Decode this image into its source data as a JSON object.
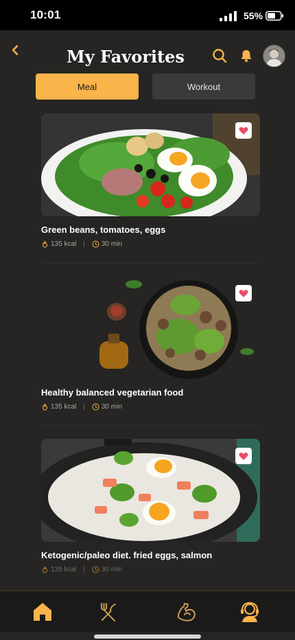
{
  "status_bar": {
    "time": "10:01",
    "battery": "55%"
  },
  "header": {
    "title": "My Favorites"
  },
  "tabs": [
    {
      "label": "Meal",
      "active": true
    },
    {
      "label": "Workout",
      "active": false
    }
  ],
  "meals": [
    {
      "name": "Green beans, tomatoes, eggs",
      "kcal": "135 kcal",
      "time": "30 min",
      "favorite": true
    },
    {
      "name": "Healthy balanced vegetarian food",
      "kcal": "135 kcal",
      "time": "30 min",
      "favorite": true
    },
    {
      "name": "Ketogenic/paleo diet. fried eggs, salmon",
      "kcal": "135 kcal",
      "time": "30 min",
      "favorite": true
    }
  ],
  "nav": [
    {
      "icon": "home-icon",
      "active": true
    },
    {
      "icon": "utensils-icon",
      "active": false
    },
    {
      "icon": "muscle-arm-icon",
      "active": false
    },
    {
      "icon": "support-agent-icon",
      "active": false
    }
  ],
  "colors": {
    "accent": "#f9b44a",
    "background": "#262523",
    "heart": "#e94e6a"
  }
}
